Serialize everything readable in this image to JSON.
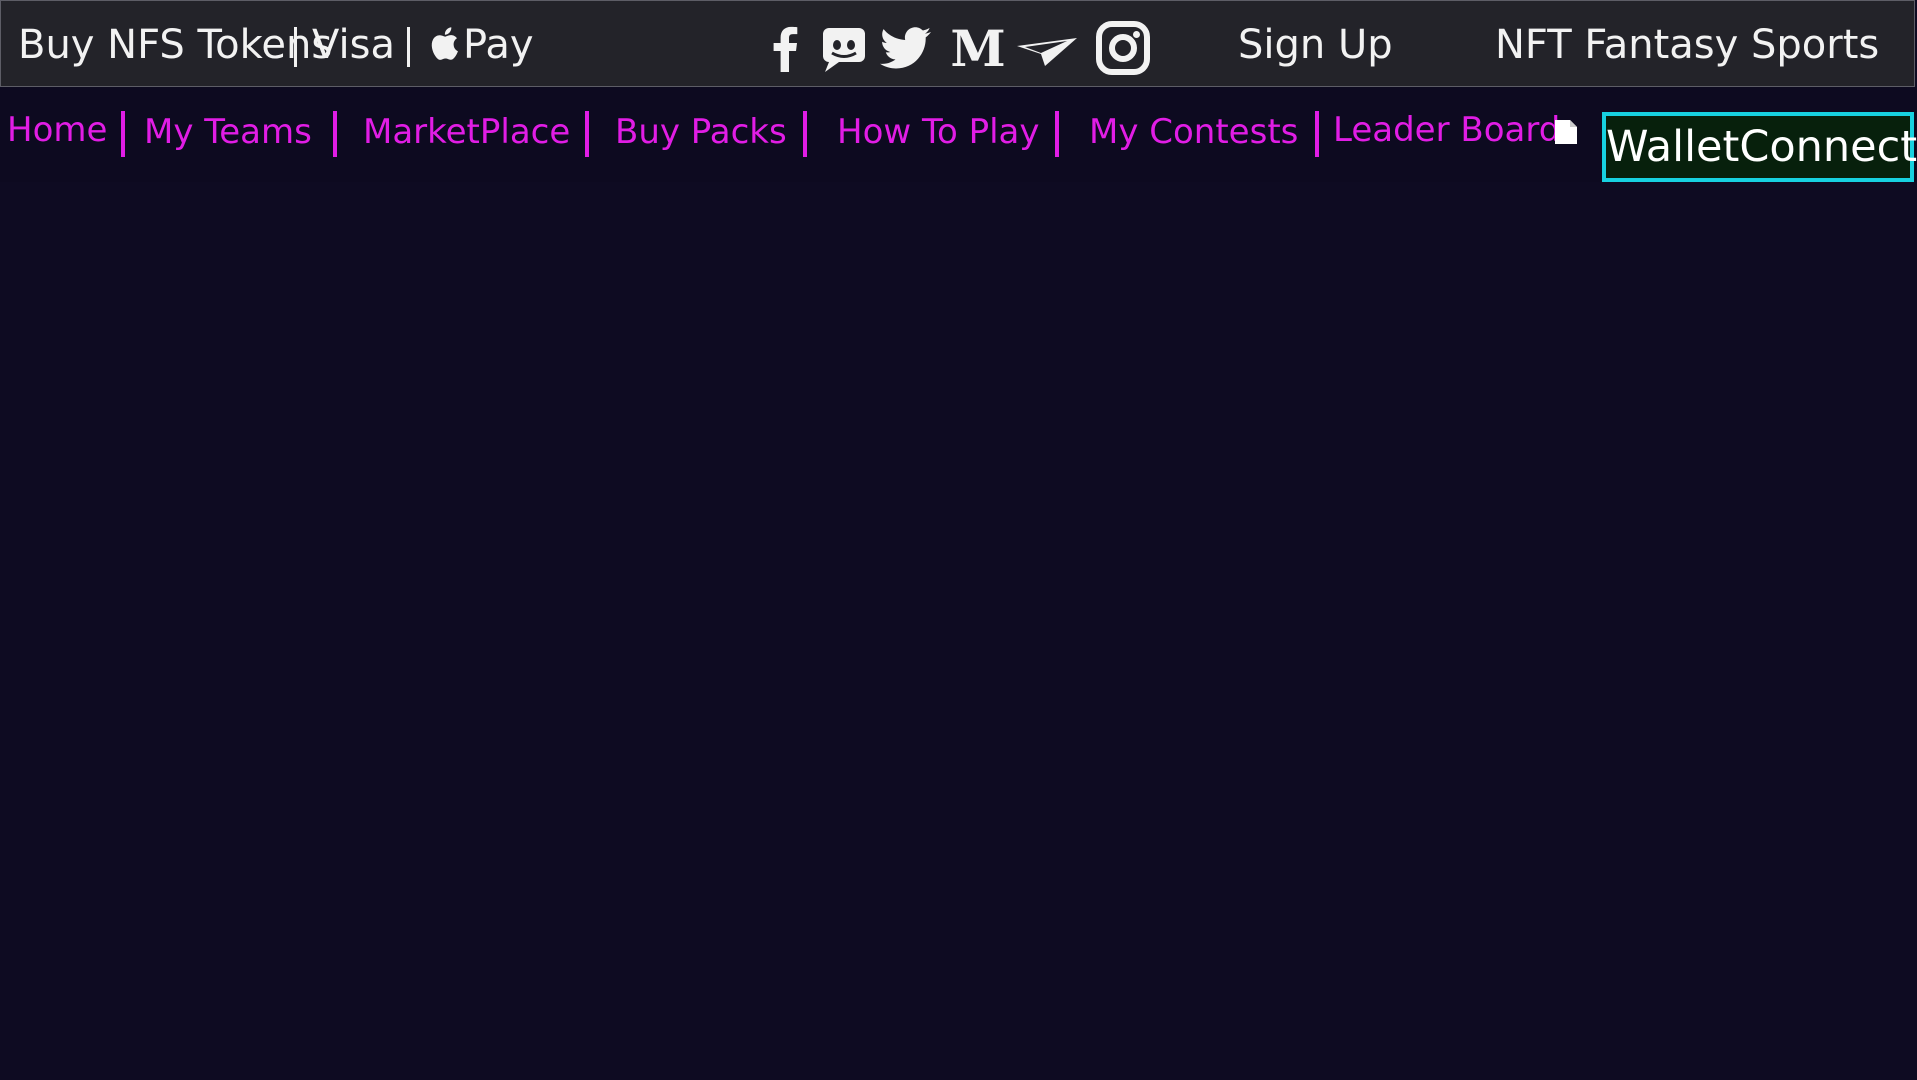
{
  "top_bar": {
    "buy_tokens": "Buy NFS Tokens",
    "visa": "Visa",
    "apple_pay": "Pay",
    "sign_up": "Sign Up",
    "brand": "NFT Fantasy Sports",
    "social_icons": [
      "facebook-icon",
      "discord-icon",
      "twitter-icon",
      "medium-icon",
      "telegram-icon",
      "instagram-icon"
    ]
  },
  "nav": {
    "items": [
      {
        "label": "Home"
      },
      {
        "label": "My Teams"
      },
      {
        "label": "MarketPlace"
      },
      {
        "label": "Buy Packs"
      },
      {
        "label": "How To Play"
      },
      {
        "label": "My Contests"
      },
      {
        "label": "Leader Board"
      }
    ],
    "wallet_connect": "WalletConnect"
  },
  "colors": {
    "top_bar_bg": "#232329",
    "nav_link": "#e11de5",
    "wallet_border": "#17d1e0",
    "hero_bg": "#0e0b22"
  }
}
